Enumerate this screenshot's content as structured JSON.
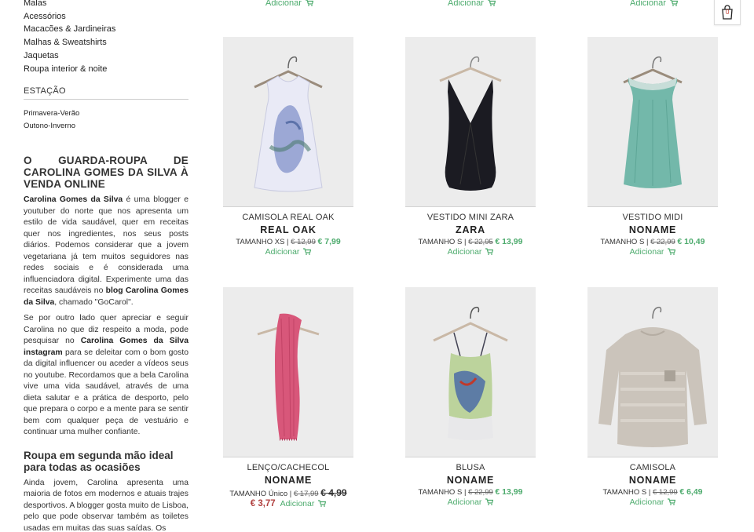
{
  "sidebar": {
    "categories": [
      "Malas",
      "Acessórios",
      "Macacões & Jardineiras",
      "Malhas & Sweatshirts",
      "Jaquetas",
      "Roupa interior & noite"
    ],
    "season_title": "ESTAÇÃO",
    "seasons": [
      "Primavera-Verão",
      "Outono-Inverno"
    ],
    "about_title_a": "O GUARDA-ROUPA DE CAROLINA GOMES DA SILVA À",
    "about_title_b": "VENDA ONLINE",
    "p1": {
      "b1": "Carolina Gomes da Silva",
      "t1": " é uma blogger e youtuber do norte que nos apresenta um estilo de vida saudável, quer em receitas quer nos ingredientes, nos seus posts diários. Podemos considerar que a jovem vegetariana já tem muitos seguidores nas redes sociais e é considerada uma influenciadora digital. Experimente uma das receitas saudáveis no ",
      "b2": "blog Carolina Gomes da Silva",
      "t2": ", chamado \"GoCarol\"."
    },
    "p2": {
      "t1": "Se por outro lado quer apreciar e seguir Carolina no que diz respeito a moda, pode pesquisar no ",
      "b1": "Carolina Gomes da Silva instagram",
      "t2": " para se deleitar com o bom gosto da digital influencer ou aceder a vídeos seus no youtube. Recordamos que a bela Carolina vive uma vida saudável, através de uma dieta salutar e a prática de desporto, pelo que prepara o corpo e a mente para se sentir bem com qualquer peça de vestuário e continuar uma mulher confiante."
    },
    "sub_title": "Roupa em segunda mão ideal para todas as ocasiões",
    "p3": "Ainda jovem, Carolina apresenta uma maioria de fotos em modernos e atuais trajes desportivos. A blogger gosta muito de Lisboa, pelo que pode observar também as toiletes usadas em muitas das suas saídas. Os"
  },
  "cart": {
    "count": "0",
    "icon": "shopping-bag-icon"
  },
  "add_label": "Adicionar",
  "products": [
    {
      "name": "CAMISOLA REAL OAK",
      "brand": "REAL OAK",
      "size": "TAMANHO XS",
      "old_price": "€ 12,99",
      "new_price": "€ 7,99"
    },
    {
      "name": "VESTIDO MINI ZARA",
      "brand": "ZARA",
      "size": "TAMANHO S",
      "old_price": "€ 22,95",
      "new_price": "€ 13,99"
    },
    {
      "name": "VESTIDO MIDI",
      "brand": "NONAME",
      "size": "TAMANHO S",
      "old_price": "€ 22,99",
      "new_price": "€ 10,49"
    },
    {
      "name": "LENÇO/CACHECOL",
      "brand": "NONAME",
      "size": "TAMANHO Único",
      "old_price": "€ 17,99",
      "mid_price": "€ 4,99",
      "new_price": "€ 3,77"
    },
    {
      "name": "BLUSA",
      "brand": "NONAME",
      "size": "TAMANHO S",
      "old_price": "€ 22,99",
      "new_price": "€ 13,99"
    },
    {
      "name": "CAMISOLA",
      "brand": "NONAME",
      "size": "TAMANHO S",
      "old_price": "€ 12,99",
      "new_price": "€ 6,49"
    }
  ],
  "colors": {
    "accent_green": "#4dab6d",
    "sale_red": "#b0403f",
    "image_bg": "#ececec"
  }
}
